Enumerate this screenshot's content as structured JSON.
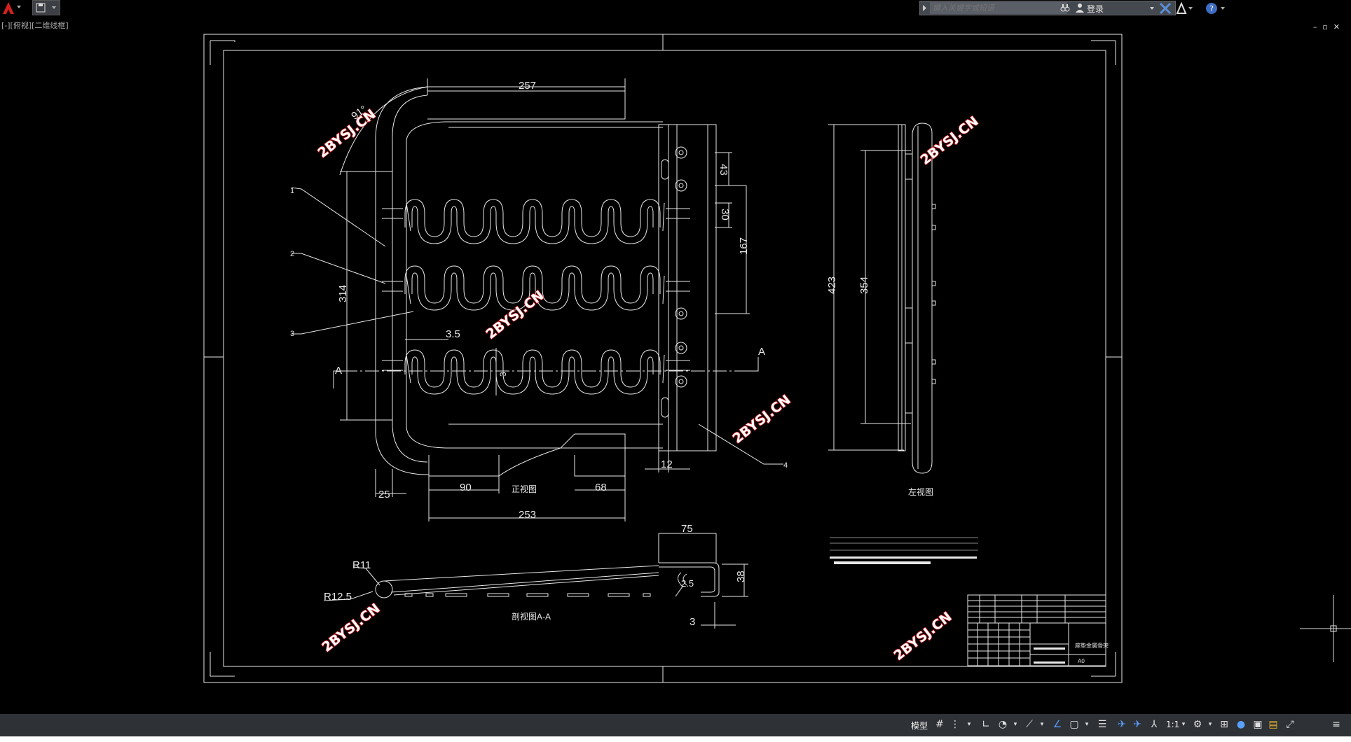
{
  "app": {
    "search_placeholder": "键入关键字或短语",
    "login_label": "登录",
    "view_label": "[-][俯视][二维线框]"
  },
  "drawing": {
    "dims": {
      "d257": "257",
      "d91": "91°",
      "d43": "43",
      "d30": "30",
      "d167": "167",
      "d314": "314",
      "d35": "3.5",
      "d3v": "3",
      "d25": "25",
      "d90": "90",
      "d68": "68",
      "d253": "253",
      "d12": "12",
      "d423": "423",
      "d354": "354",
      "d75": "75",
      "d38": "38",
      "d25b": "2.5",
      "d3b": "3",
      "r11": "R11",
      "r125": "R12.5",
      "secA1": "A",
      "secA2": "A"
    },
    "labels": {
      "front": "正视图",
      "left": "左视图",
      "section": "剖视图A-A",
      "l1": "1",
      "l2": "2",
      "l3": "3",
      "l4": "4"
    },
    "watermark": "2BYSJ.CN",
    "title_name": "座垫金属骨架",
    "sheet": "A0"
  },
  "statusbar": {
    "model": "模型",
    "scale": "1:1"
  },
  "colors": {
    "background": "#000000",
    "line": "#e8e8e8",
    "watermark": "#d8141a",
    "statusbar": "#2e3136"
  }
}
